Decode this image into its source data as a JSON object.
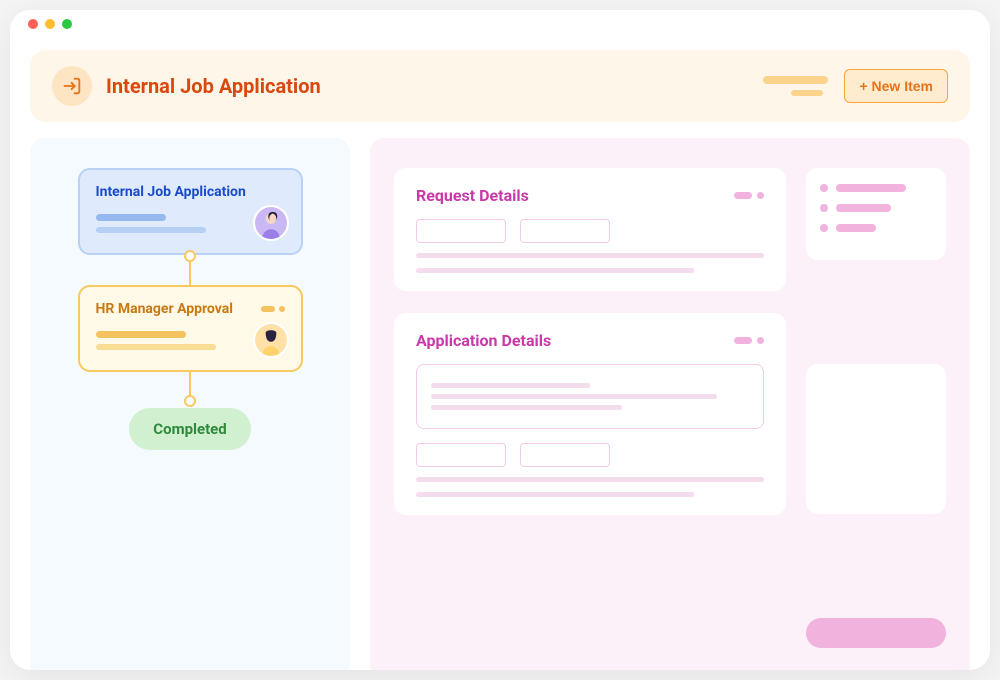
{
  "header": {
    "title": "Internal Job Application",
    "new_item_button": "+ New Item"
  },
  "workflow": {
    "step1": {
      "title": "Internal Job Application"
    },
    "step2": {
      "title": "HR Manager Approval"
    },
    "completed_label": "Completed"
  },
  "details": {
    "request": {
      "title": "Request Details"
    },
    "application": {
      "title": "Application Details"
    }
  }
}
